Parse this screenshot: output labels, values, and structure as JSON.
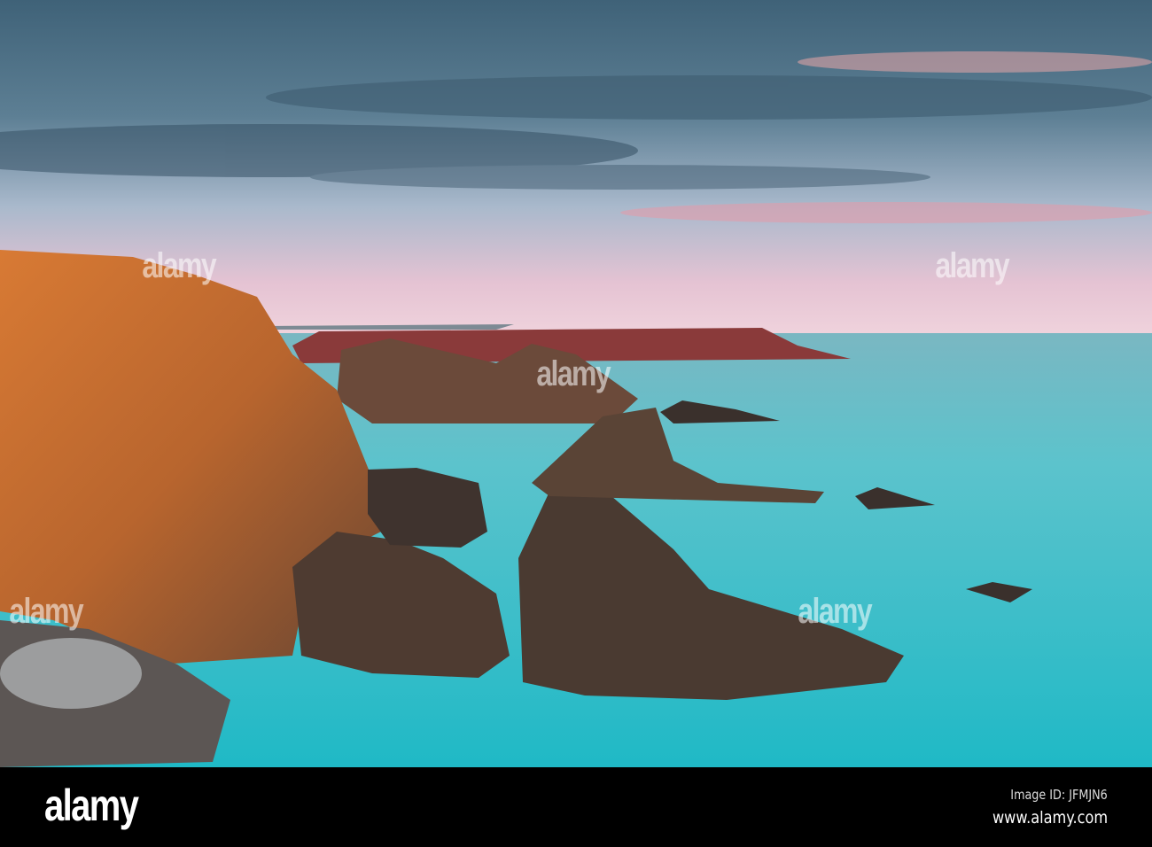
{
  "photo": {
    "subject": "coastal-cliffs-sea-stacks-at-sunset",
    "colors": {
      "sky_top": "#4c6d82",
      "sky_pink": "#e9c2cf",
      "sea": "#3fc3cc",
      "cliff": "#c8702c",
      "rock": "#4a3a30"
    }
  },
  "watermark": {
    "text": "alamy"
  },
  "footer": {
    "logo": "alamy",
    "image_id": "Image ID: JFMJN6",
    "website": "www.alamy.com"
  }
}
